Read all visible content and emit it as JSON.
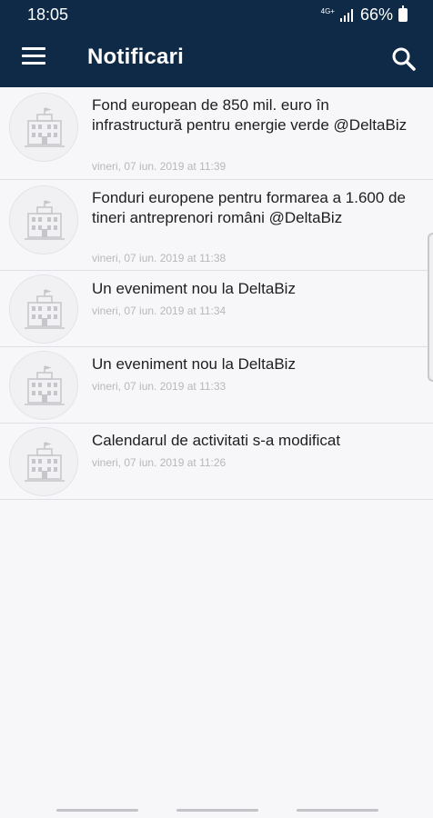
{
  "status_bar": {
    "time": "18:05",
    "network": "4G+",
    "battery": "66%"
  },
  "app_bar": {
    "title": "Notificari",
    "menu_icon": "hamburger-menu-icon",
    "search_icon": "search-icon"
  },
  "notifications": [
    {
      "title": "Fond european de 850 mil. euro în infrastructură pentru energie verde @DeltaBiz",
      "time": "vineri, 07 iun. 2019 at 11:39",
      "icon": "government-building-icon"
    },
    {
      "title": "Fonduri europene pentru formarea a 1.600 de tineri antreprenori români @DeltaBiz",
      "time": "vineri, 07 iun. 2019 at 11:38",
      "icon": "government-building-icon"
    },
    {
      "title": "Un eveniment nou la DeltaBiz",
      "time": "vineri, 07 iun. 2019 at 11:34",
      "icon": "government-building-icon"
    },
    {
      "title": "Un eveniment nou la DeltaBiz",
      "time": "vineri, 07 iun. 2019 at 11:33",
      "icon": "government-building-icon"
    },
    {
      "title": "Calendarul de activitati s-a modificat",
      "time": "vineri, 07 iun. 2019 at 11:26",
      "icon": "government-building-icon"
    }
  ],
  "colors": {
    "app_bar": "#0e2a47",
    "background": "#f7f7f9",
    "title_text": "#1e1e1e",
    "time_text": "#b8b8bc",
    "divider": "#dcdfe4"
  }
}
